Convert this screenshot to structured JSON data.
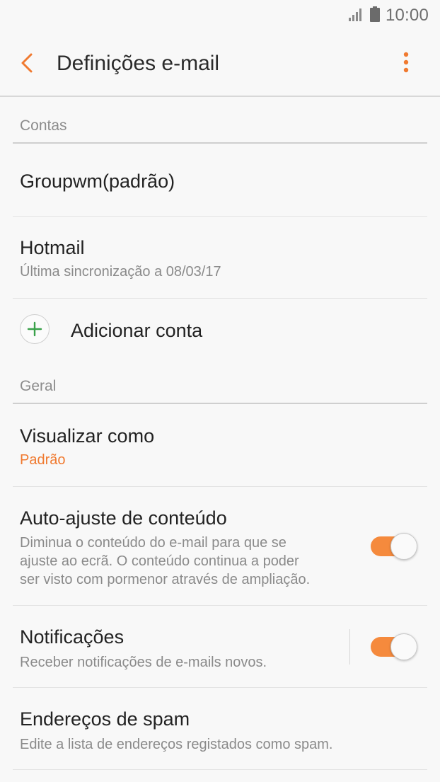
{
  "status_bar": {
    "time": "10:00",
    "signal_icon": "signal-icon",
    "battery_icon": "battery-icon"
  },
  "app_bar": {
    "title": "Definições e-mail",
    "back_icon": "back-arrow-icon",
    "more_icon": "more-vert-icon"
  },
  "sections": {
    "accounts": {
      "header": "Contas",
      "items": [
        {
          "title": "Groupwm(padrão)"
        },
        {
          "title": "Hotmail",
          "subtitle": "Última sincronização a 08/03/17"
        }
      ],
      "add_account": {
        "label": "Adicionar conta",
        "icon": "plus-icon"
      }
    },
    "general": {
      "header": "Geral",
      "view_as": {
        "title": "Visualizar como",
        "value": "Padrão"
      },
      "auto_fit": {
        "title": "Auto-ajuste de conteúdo",
        "subtitle_lines": [
          "Diminua o conteúdo do e-mail para que se",
          "ajuste ao ecrã. O conteúdo continua a poder",
          "ser visto com pormenor através de ampliação."
        ],
        "enabled": true
      },
      "notifications": {
        "title": "Notificações",
        "subtitle": "Receber notificações de e-mails novos.",
        "enabled": true
      },
      "spam": {
        "title": "Endereços de spam",
        "subtitle": "Edite a lista de endereços registados como spam."
      }
    }
  },
  "colors": {
    "accent": "#f07a30",
    "toggle_on": "#f58a3d",
    "add_plus": "#3aa14a"
  }
}
